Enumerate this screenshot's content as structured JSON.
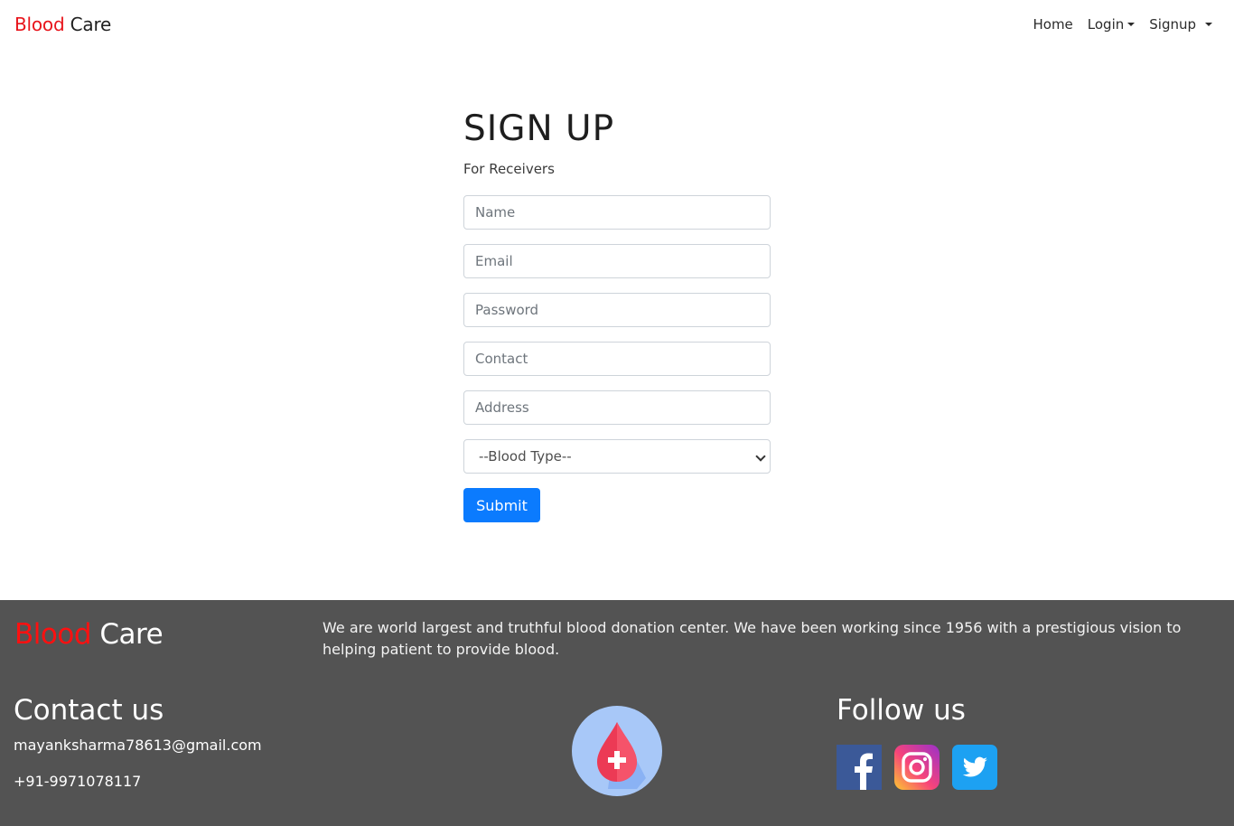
{
  "navbar": {
    "brand_red": "Blood",
    "brand_dark": "Care",
    "links": {
      "home": "Home",
      "login": "Login",
      "signup": "Signup"
    }
  },
  "form": {
    "title": "SIGN UP",
    "subtitle": "For Receivers",
    "fields": {
      "name_placeholder": "Name",
      "email_placeholder": "Email",
      "password_placeholder": "Password",
      "contact_placeholder": "Contact",
      "address_placeholder": "Address"
    },
    "blood_type_selected": "--Blood Type--",
    "submit_label": "Submit"
  },
  "footer": {
    "brand_red": "Blood",
    "brand_white": "Care",
    "about": "We are world largest and truthful blood donation center. We have been working since 1956 with a prestigious vision to helping patient to provide blood.",
    "contact_title": "Contact us",
    "email": "mayanksharma78613@gmail.com",
    "phone": "+91-9971078117",
    "follow_title": "Follow us",
    "social_icons": [
      "facebook-icon",
      "instagram-icon",
      "twitter-icon"
    ]
  },
  "colors": {
    "brand_red": "#e8141b",
    "primary_button": "#0b7bfe",
    "footer_bg": "#535353",
    "facebook": "#3b5998",
    "twitter": "#1da1f2"
  }
}
